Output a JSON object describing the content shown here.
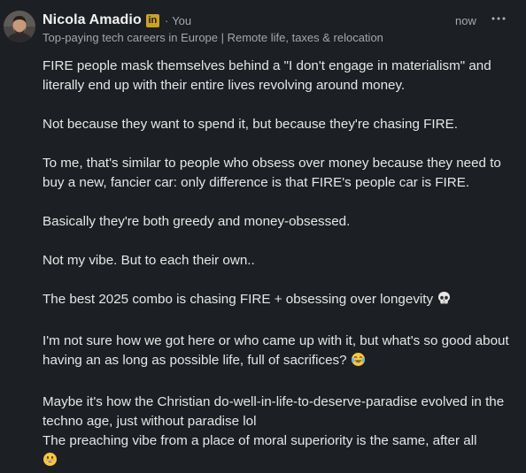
{
  "post": {
    "author": {
      "name": "Nicola Amadio",
      "badge_label": "in",
      "separator": "·",
      "relation": "You",
      "headline": "Top-paying tech careers in Europe | Remote life, taxes & relocation"
    },
    "timestamp": "now",
    "more_icon": "ellipsis-icon",
    "paragraphs": [
      "FIRE people mask themselves behind a \"I don't engage in materialism\" and literally end up with their entire lives revolving around money.",
      "Not because they want to spend it, but because they're chasing FIRE.",
      "To me, that's similar to people who obsess over money because they need to buy a new, fancier car: only difference is that FIRE's people car is FIRE.",
      "Basically they're both greedy and money-obsessed.",
      "Not my vibe. But to each their own..",
      "The best 2025 combo is chasing FIRE + obsessing over longevity",
      "I'm not sure how we got here or who came up with it, but what's so good about having an as long as possible life, full of sacrifices?",
      "Maybe it's how the Christian do-well-in-life-to-deserve-paradise evolved in the techno age, just without paradise lol\nThe preaching vibe from a place of moral superiority is the same, after all"
    ],
    "emojis": {
      "skull": "skull-icon",
      "laughing": "tears-of-joy-icon",
      "grin": "grinning-icon"
    }
  },
  "colors": {
    "background": "#1c1f23",
    "text": "#e6e6e6",
    "secondary_text": "#a7a7a7",
    "badge": "#c9a227"
  }
}
